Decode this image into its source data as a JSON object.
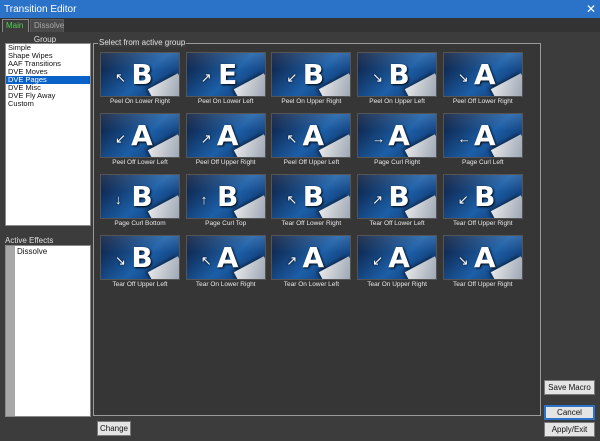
{
  "window": {
    "title": "Transition Editor",
    "close_glyph": "✕"
  },
  "tabs": [
    {
      "label": "Main",
      "active": true
    },
    {
      "label": "Dissolve",
      "active": false
    }
  ],
  "group": {
    "label": "Group",
    "items": [
      "Simple",
      "Shape Wipes",
      "AAF Transitions",
      "DVE Moves",
      "DVE Pages",
      "DVE Misc",
      "DVE Fly Away",
      "Custom"
    ],
    "selected": "DVE Pages"
  },
  "active_effects": {
    "label": "Active Effects",
    "items": [
      "Dissolve"
    ]
  },
  "grid": {
    "label": "Select from active group",
    "transitions": [
      {
        "caption": "Peel On Lower Right",
        "glyph": "B",
        "arrow": "↖"
      },
      {
        "caption": "Peel On Lower Left",
        "glyph": "E",
        "arrow": "↗"
      },
      {
        "caption": "Peel On Upper Right",
        "glyph": "B",
        "arrow": "↙"
      },
      {
        "caption": "Peel On Upper Left",
        "glyph": "B",
        "arrow": "↘"
      },
      {
        "caption": "Peel Off Lower Right",
        "glyph": "A",
        "arrow": "↘"
      },
      {
        "caption": "Peel Off Lower Left",
        "glyph": "A",
        "arrow": "↙"
      },
      {
        "caption": "Peel Off Upper Right",
        "glyph": "A",
        "arrow": "↗"
      },
      {
        "caption": "Peel Off Upper Left",
        "glyph": "A",
        "arrow": "↖"
      },
      {
        "caption": "Page Curl Right",
        "glyph": "A",
        "arrow": "→"
      },
      {
        "caption": "Page Curl Left",
        "glyph": "A",
        "arrow": "←"
      },
      {
        "caption": "Page Curl Bottom",
        "glyph": "B",
        "arrow": "↓"
      },
      {
        "caption": "Page Curl Top",
        "glyph": "B",
        "arrow": "↑"
      },
      {
        "caption": "Tear Off Lower Right",
        "glyph": "B",
        "arrow": "↖"
      },
      {
        "caption": "Tear Off Lower Left",
        "glyph": "B",
        "arrow": "↗"
      },
      {
        "caption": "Tear Off Upper Right",
        "glyph": "B",
        "arrow": "↙"
      },
      {
        "caption": "Tear Off Upper Left",
        "glyph": "B",
        "arrow": "↘"
      },
      {
        "caption": "Tear On Lower Right",
        "glyph": "A",
        "arrow": "↖"
      },
      {
        "caption": "Tear On Lower Left",
        "glyph": "A",
        "arrow": "↗"
      },
      {
        "caption": "Tear On Upper Right",
        "glyph": "A",
        "arrow": "↙"
      },
      {
        "caption": "Tear Off Upper Right",
        "glyph": "A",
        "arrow": "↘"
      }
    ]
  },
  "buttons": {
    "change": "Change",
    "save_macro": "Save Macro",
    "cancel": "Cancel",
    "apply_exit": "Apply/Exit"
  },
  "colors": {
    "titlebar": "#2b73c8",
    "selection": "#0a62c9",
    "active_tab_text": "#4fd24f"
  }
}
